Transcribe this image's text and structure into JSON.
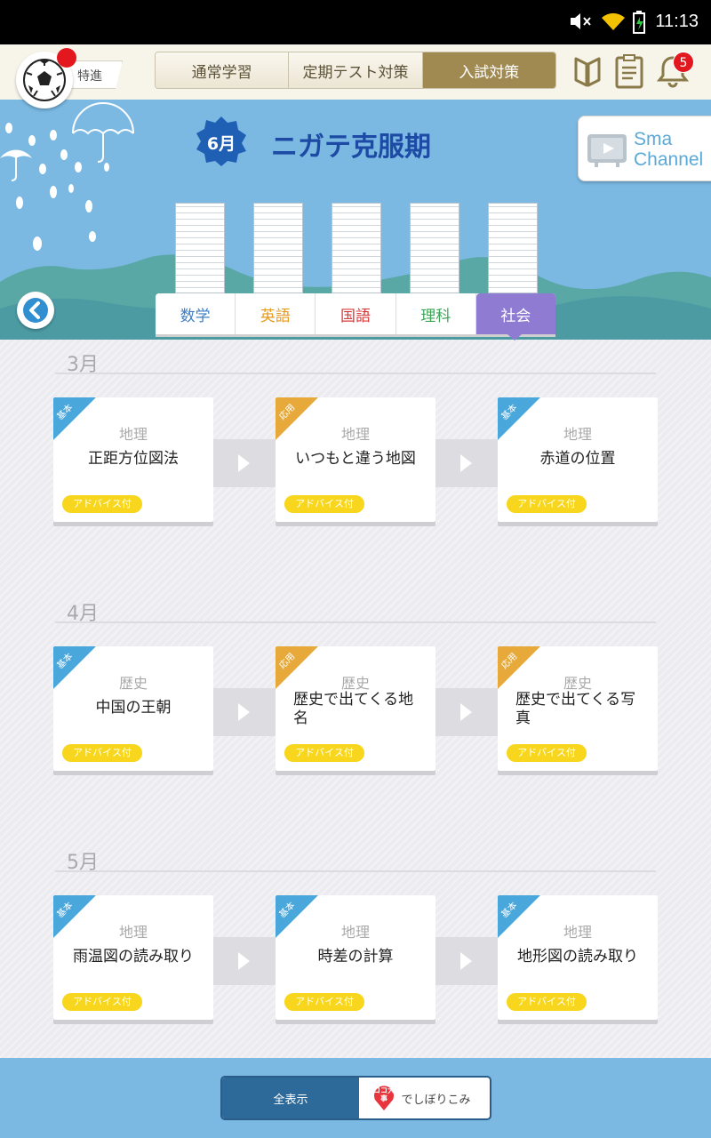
{
  "status_bar": {
    "time": "11:13"
  },
  "header": {
    "logo_label": "特進",
    "segments": [
      {
        "label": "通常学習",
        "active": false
      },
      {
        "label": "定期テスト対策",
        "active": false
      },
      {
        "label": "入試対策",
        "active": true
      }
    ],
    "notification_count": "5"
  },
  "hero": {
    "month_badge": "6月",
    "title": "ニガテ克服期",
    "channel_line1": "Sma",
    "channel_line2": "Channel"
  },
  "subject_tabs": [
    {
      "label": "数学",
      "color": "#3f7fc4",
      "active": false
    },
    {
      "label": "英語",
      "color": "#e59b1e",
      "active": false
    },
    {
      "label": "国語",
      "color": "#d83b3b",
      "active": false
    },
    {
      "label": "理科",
      "color": "#3ea45a",
      "active": false
    },
    {
      "label": "社会",
      "color": "#ffffff",
      "active": true
    }
  ],
  "months": [
    {
      "label": "3月",
      "cards": [
        {
          "tag": "基本",
          "type": "basic",
          "category": "地理",
          "title": "正距方位図法",
          "advice": "アドバイス付"
        },
        {
          "tag": "応用",
          "type": "applied",
          "category": "地理",
          "title": "いつもと違う地図",
          "advice": "アドバイス付"
        },
        {
          "tag": "基本",
          "type": "basic",
          "category": "地理",
          "title": "赤道の位置",
          "advice": "アドバイス付"
        }
      ]
    },
    {
      "label": "4月",
      "cards": [
        {
          "tag": "基本",
          "type": "basic",
          "category": "歴史",
          "title": "中国の王朝",
          "advice": "アドバイス付"
        },
        {
          "tag": "応用",
          "type": "applied",
          "category": "歴史",
          "title": "歴史で出てくる地名",
          "advice": "アドバイス付"
        },
        {
          "tag": "応用",
          "type": "applied",
          "category": "歴史",
          "title": "歴史で出てくる写真",
          "advice": "アドバイス付"
        }
      ]
    },
    {
      "label": "5月",
      "cards": [
        {
          "tag": "基本",
          "type": "basic",
          "category": "地理",
          "title": "雨温図の読み取り",
          "advice": "アドバイス付"
        },
        {
          "tag": "基本",
          "type": "basic",
          "category": "地理",
          "title": "時差の計算",
          "advice": "アドバイス付"
        },
        {
          "tag": "基本",
          "type": "basic",
          "category": "地理",
          "title": "地形図の読み取り",
          "advice": "アドバイス付"
        }
      ]
    }
  ],
  "filter": {
    "all_label": "全表示",
    "pin_text": "ココ大事",
    "narrow_label": "でしぼりこみ"
  }
}
